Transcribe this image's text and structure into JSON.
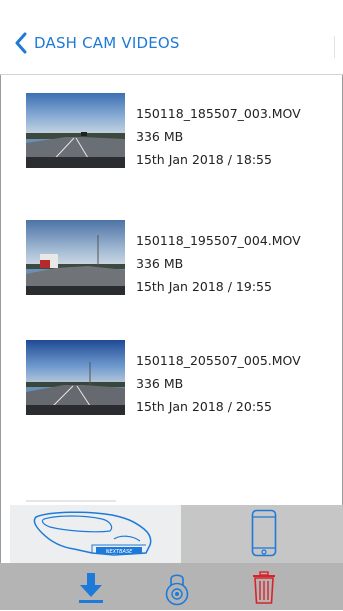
{
  "header": {
    "title": "DASH CAM VIDEOS"
  },
  "videos": [
    {
      "filename": "150118_185507_003.MOV",
      "size": "336 MB",
      "date": "15th Jan 2018 / 18:55"
    },
    {
      "filename": "150118_195507_004.MOV",
      "size": "336 MB",
      "date": "15th Jan 2018 / 19:55"
    },
    {
      "filename": "150118_205507_005.MOV",
      "size": "336 MB",
      "date": "15th Jan 2018 / 20:55"
    }
  ],
  "camera_logo": "NEXTBASE",
  "colors": {
    "accent_blue": "#1e7ad8",
    "delete_red": "#d8232a"
  },
  "icons": {
    "back": "chevron-left-icon",
    "camera": "dash-cam-icon",
    "phone": "phone-icon",
    "download": "download-icon",
    "lock": "lock-icon",
    "delete": "trash-icon"
  }
}
